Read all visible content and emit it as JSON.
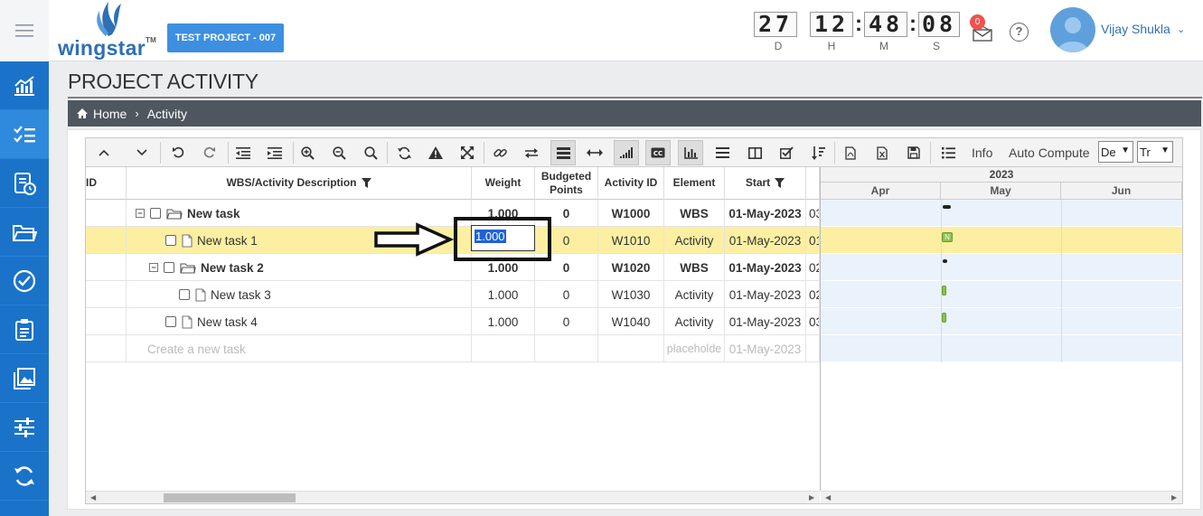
{
  "header": {
    "logo_text": "wingstar",
    "logo_tm": "TM",
    "project_button": "TEST PROJECT - 007",
    "timer": {
      "days": "27",
      "hours": "12",
      "minutes": "48",
      "seconds": "08",
      "days_label": "D",
      "hours_label": "H",
      "minutes_label": "M",
      "seconds_label": "S"
    },
    "notification_count": "0",
    "help_label": "?",
    "user_name": "Vijay Shukla"
  },
  "sidebar": {
    "items": [
      {
        "icon": "dashboard-chart-icon"
      },
      {
        "icon": "checklist-icon",
        "active": true
      },
      {
        "icon": "report-clock-icon"
      },
      {
        "icon": "folder-open-icon"
      },
      {
        "icon": "check-circle-icon"
      },
      {
        "icon": "clipboard-icon"
      },
      {
        "icon": "gallery-icon"
      },
      {
        "icon": "sliders-icon"
      },
      {
        "icon": "sync-icon"
      }
    ]
  },
  "page": {
    "title": "PROJECT ACTIVITY",
    "breadcrumb": {
      "home": "Home",
      "separator": "›",
      "current": "Activity"
    }
  },
  "toolbar": {
    "info_label": "Info",
    "auto_compute_label": "Auto Compute",
    "select1_value": "De",
    "select2_value": "Tr"
  },
  "columns": {
    "id": "ID",
    "description": "WBS/Activity Description",
    "weight": "Weight",
    "budgeted_points": "Budgeted Points",
    "activity_id": "Activity ID",
    "element": "Element",
    "start": "Start"
  },
  "rows": [
    {
      "name": "New task",
      "weight": "1.000",
      "points": "0",
      "activity_id": "W1000",
      "element": "WBS",
      "start": "01-May-2023",
      "next": "03"
    },
    {
      "name": "New task 1",
      "weight": "1.000",
      "points": "0",
      "activity_id": "W1010",
      "element": "Activity",
      "start": "01-May-2023",
      "next": "01"
    },
    {
      "name": "New task 2",
      "weight": "1.000",
      "points": "0",
      "activity_id": "W1020",
      "element": "WBS",
      "start": "01-May-2023",
      "next": "02"
    },
    {
      "name": "New task 3",
      "weight": "1.000",
      "points": "0",
      "activity_id": "W1030",
      "element": "Activity",
      "start": "01-May-2023",
      "next": "02"
    },
    {
      "name": "New task 4",
      "weight": "1.000",
      "points": "0",
      "activity_id": "W1040",
      "element": "Activity",
      "start": "01-May-2023",
      "next": "03"
    }
  ],
  "new_row": {
    "placeholder": "Create a new task",
    "element_placeholder": "placeholde",
    "start": "01-May-2023"
  },
  "editor_value": "1.000",
  "gantt": {
    "year": "2023",
    "months": [
      "Apr",
      "May",
      "Jun"
    ],
    "bar_label": "N"
  }
}
